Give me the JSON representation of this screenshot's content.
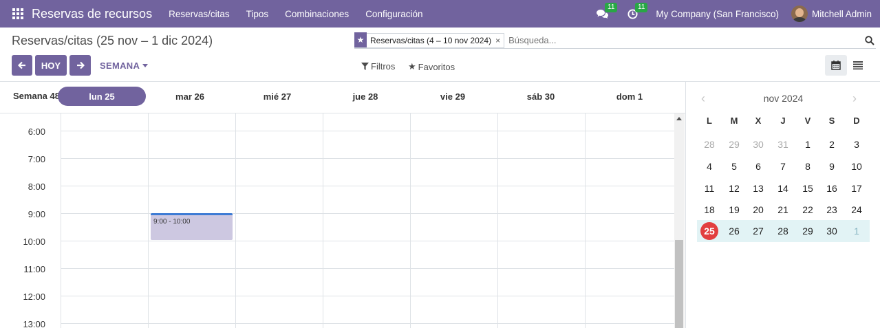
{
  "navbar": {
    "brand": "Reservas de recursos",
    "menu": [
      "Reservas/citas",
      "Tipos",
      "Combinaciones",
      "Configuración"
    ],
    "messages_badge": "11",
    "activities_badge": "11",
    "company": "My Company (San Francisco)",
    "user": "Mitchell Admin",
    "bg_color": "#71639e"
  },
  "control_panel": {
    "breadcrumb": "Reservas/citas (25 nov – 1 dic 2024)",
    "prev_icon": "arrow-left-icon",
    "today_label": "HOY",
    "next_icon": "arrow-right-icon",
    "scale_label": "SEMANA",
    "search": {
      "facet_value": "Reservas/citas (4 – 10 nov 2024)",
      "facet_close": "×",
      "placeholder": "Búsqueda..."
    },
    "filters_label": "Filtros",
    "favorites_label": "Favoritos",
    "views": [
      "calendar-icon",
      "list-icon"
    ]
  },
  "calendar": {
    "week_label": "Semana 48",
    "days": [
      "lun 25",
      "mar 26",
      "mié 27",
      "jue 28",
      "vie 29",
      "sáb 30",
      "dom 1"
    ],
    "today_index": 0,
    "hours": [
      "6:00",
      "7:00",
      "8:00",
      "9:00",
      "10:00",
      "11:00",
      "12:00",
      "13:00"
    ],
    "events": [
      {
        "time": "9:00 - 10:00",
        "day": "mar 26"
      }
    ]
  },
  "mini_calendar": {
    "title": "nov 2024",
    "weekdays": [
      "L",
      "M",
      "X",
      "J",
      "V",
      "S",
      "D"
    ],
    "weeks": [
      [
        "28",
        "29",
        "30",
        "31",
        "1",
        "2",
        "3"
      ],
      [
        "4",
        "5",
        "6",
        "7",
        "8",
        "9",
        "10"
      ],
      [
        "11",
        "12",
        "13",
        "14",
        "15",
        "16",
        "17"
      ],
      [
        "18",
        "19",
        "20",
        "21",
        "22",
        "23",
        "24"
      ],
      [
        "25",
        "26",
        "27",
        "28",
        "29",
        "30",
        "1"
      ]
    ],
    "today": "25"
  }
}
